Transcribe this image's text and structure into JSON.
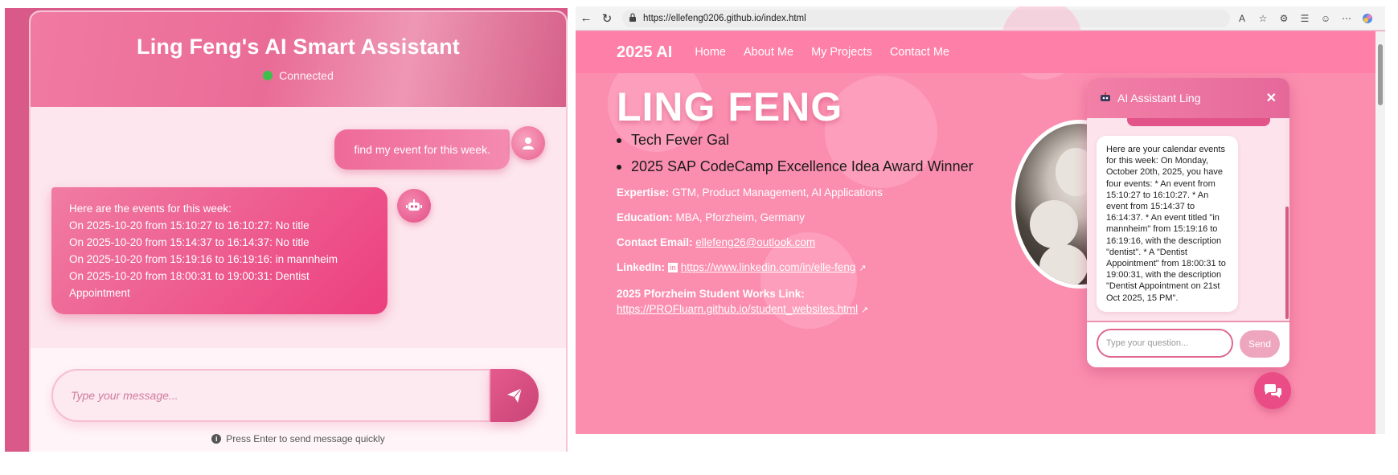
{
  "left_chat": {
    "title": "Ling Feng's AI Smart Assistant",
    "status": "Connected",
    "user_message": "find my event for this week.",
    "bot_message_lines": [
      "Here are the events for this week:",
      "On 2025-10-20 from 15:10:27 to 16:10:27: No title",
      "On 2025-10-20 from 15:14:37 to 16:14:37: No title",
      "On 2025-10-20 from 15:19:16 to 16:19:16: in mannheim",
      "On 2025-10-20 from 18:00:31 to 19:00:31: Dentist Appointment"
    ],
    "input_placeholder": "Type your message...",
    "hint": "Press Enter to send message quickly",
    "colors": {
      "accent": "#e96c97",
      "status_dot": "#3fbf4a"
    }
  },
  "browser": {
    "url": "https://ellefeng0206.github.io/index.html"
  },
  "site": {
    "brand": "2025 AI",
    "nav": [
      "Home",
      "About Me",
      "My Projects",
      "Contact Me"
    ],
    "hero_name": "LING FENG",
    "bullets": [
      "Tech Fever Gal",
      "2025 SAP CodeCamp Excellence Idea Award Winner"
    ],
    "expertise_label": "Expertise:",
    "expertise": "GTM, Product Management, AI Applications",
    "education_label": "Education:",
    "education": "MBA, Pforzheim, Germany",
    "email_label": "Contact Email:",
    "email": "ellefeng26@outlook.com",
    "linkedin_label": "LinkedIn:",
    "linkedin": "https://www.linkedin.com/in/elle-feng",
    "student_works_label": "2025 Pforzheim Student Works Link:",
    "student_works": "https://PROFluarn.github.io/student_websites.html"
  },
  "widget": {
    "title": "AI Assistant Ling",
    "message": "Here are your calendar events for this week: On Monday, October 20th, 2025, you have four events: * An event from 15:10:27 to 16:10:27. * An event from 15:14:37 to 16:14:37. * An event titled \"in mannheim\" from 15:19:16 to 16:19:16, with the description \"dentist\". * A \"Dentist Appointment\" from 18:00:31 to 19:00:31, with the description \"Dentist Appointment on 21st Oct 2025, 15 PM\".",
    "input_placeholder": "Type your question...",
    "send_label": "Send"
  }
}
